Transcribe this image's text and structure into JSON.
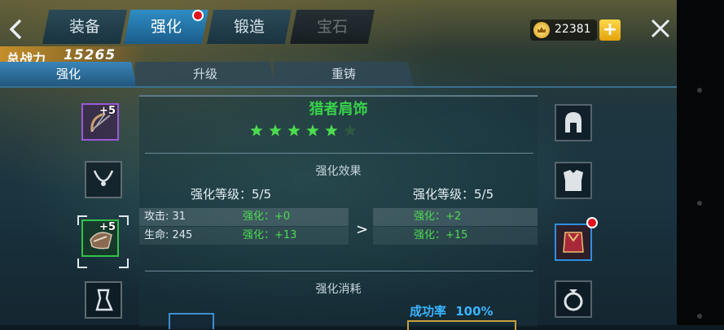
{
  "tabs": [
    {
      "label": "装备",
      "state": "normal"
    },
    {
      "label": "强化",
      "state": "active",
      "badge": true
    },
    {
      "label": "锻造",
      "state": "normal"
    },
    {
      "label": "宝石",
      "state": "disabled"
    }
  ],
  "currency": {
    "amount": "22381",
    "icon": "crown-coin-icon",
    "add_label": "+"
  },
  "power": {
    "label": "总战力",
    "value": "15265"
  },
  "subtabs": [
    {
      "label": "强化",
      "state": "active"
    },
    {
      "label": "升级",
      "state": "normal"
    },
    {
      "label": "重铸",
      "state": "normal"
    }
  ],
  "left_slots": [
    {
      "name": "bow",
      "icon": "bow-icon",
      "level": "+5"
    },
    {
      "name": "necklace",
      "icon": "necklace-icon",
      "level": ""
    },
    {
      "name": "shoulder",
      "icon": "shoulder-guard-icon",
      "level": "+5",
      "selected": true
    },
    {
      "name": "bracer",
      "icon": "bracer-icon",
      "level": ""
    }
  ],
  "right_slots": [
    {
      "name": "helmet",
      "icon": "helmet-icon"
    },
    {
      "name": "armor",
      "icon": "armor-icon"
    },
    {
      "name": "cloak",
      "icon": "cloak-icon",
      "badge": true
    },
    {
      "name": "ring",
      "icon": "ring-icon"
    }
  ],
  "item": {
    "name": "猎者肩饰",
    "stars_filled": 5,
    "stars_total": 6
  },
  "effect": {
    "title": "强化效果",
    "current_level": "强化等级：5/5",
    "next_level": "强化等级：5/5",
    "current_stats": [
      {
        "stat": "攻击: 31",
        "bonus": "强化：+0"
      },
      {
        "stat": "生命: 245",
        "bonus": "强化：+13"
      }
    ],
    "next_stats": [
      {
        "bonus": "强化：+2"
      },
      {
        "bonus": "强化：+15"
      }
    ]
  },
  "cost": {
    "title": "强化消耗",
    "rate_label": "成功率",
    "rate_value": "100%"
  },
  "colors": {
    "accent": "#2f8dc4",
    "green": "#4bdc4f",
    "gold": "#e3a20d",
    "badge": "#e0131c"
  }
}
